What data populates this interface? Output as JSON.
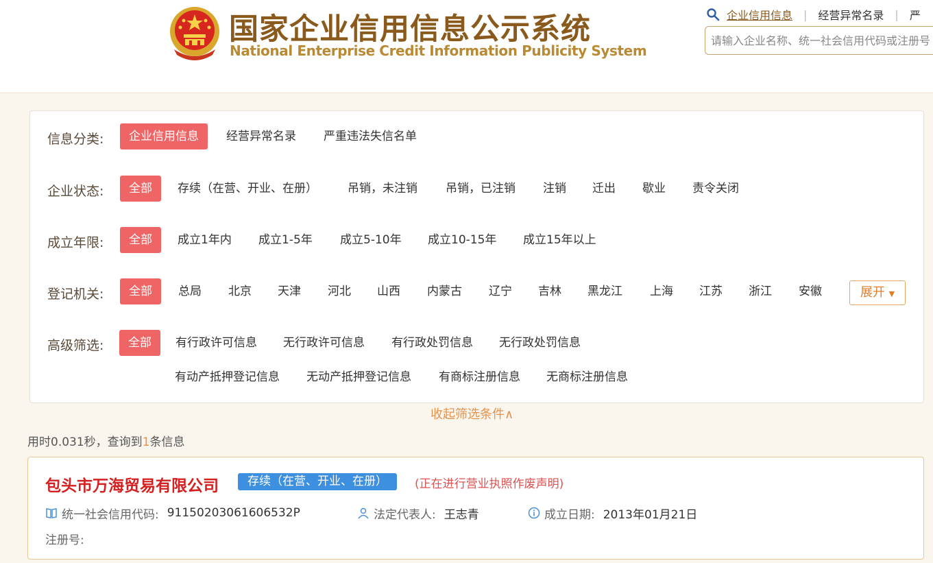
{
  "header": {
    "title_cn": "国家企业信用信息公示系统",
    "title_en": "National Enterprise Credit Information Publicity System",
    "nav": [
      "企业信用信息",
      "经营异常名录",
      "严"
    ],
    "search_placeholder": "请输入企业名称、统一社会信用代码或注册号"
  },
  "filters": {
    "info_category": {
      "label": "信息分类:",
      "options": [
        "企业信用信息",
        "经营异常名录",
        "严重违法失信名单"
      ]
    },
    "company_status": {
      "label": "企业状态:",
      "options": [
        "全部",
        "存续（在营、开业、在册）",
        "吊销，未注销",
        "吊销，已注销",
        "注销",
        "迁出",
        "歇业",
        "责令关闭"
      ]
    },
    "established": {
      "label": "成立年限:",
      "options": [
        "全部",
        "成立1年内",
        "成立1-5年",
        "成立5-10年",
        "成立10-15年",
        "成立15年以上"
      ]
    },
    "registry": {
      "label": "登记机关:",
      "options": [
        "全部",
        "总局",
        "北京",
        "天津",
        "河北",
        "山西",
        "内蒙古",
        "辽宁",
        "吉林",
        "黑龙江",
        "上海",
        "江苏",
        "浙江",
        "安徽"
      ],
      "expand_label": "展开"
    },
    "advanced": {
      "label": "高级筛选:",
      "options_row1": [
        "全部",
        "有行政许可信息",
        "无行政许可信息",
        "有行政处罚信息",
        "无行政处罚信息"
      ],
      "options_row2": [
        "有动产抵押登记信息",
        "无动产抵押登记信息",
        "有商标注册信息",
        "无商标注册信息"
      ]
    },
    "collapse_label": "收起筛选条件∧"
  },
  "results": {
    "summary_prefix": "用时0.031秒，查询到",
    "count": "1",
    "summary_suffix": "条信息",
    "items": [
      {
        "name": "包头市万海贸易有限公司",
        "status": "存续（在营、开业、在册）",
        "note": "(正在进行营业执照作废声明)",
        "credit_code_label": "统一社会信用代码:",
        "credit_code": "91150203061606532P",
        "legal_rep_label": "法定代表人:",
        "legal_rep": "王志青",
        "founded_label": "成立日期:",
        "founded": "2013年01月21日",
        "reg_no_label": "注册号:"
      }
    ]
  },
  "colors": {
    "active_chip": "#ef6464",
    "brand_brown": "#8a5a1c",
    "status_blue": "#3d8fe0",
    "accent_orange": "#e8914a"
  }
}
